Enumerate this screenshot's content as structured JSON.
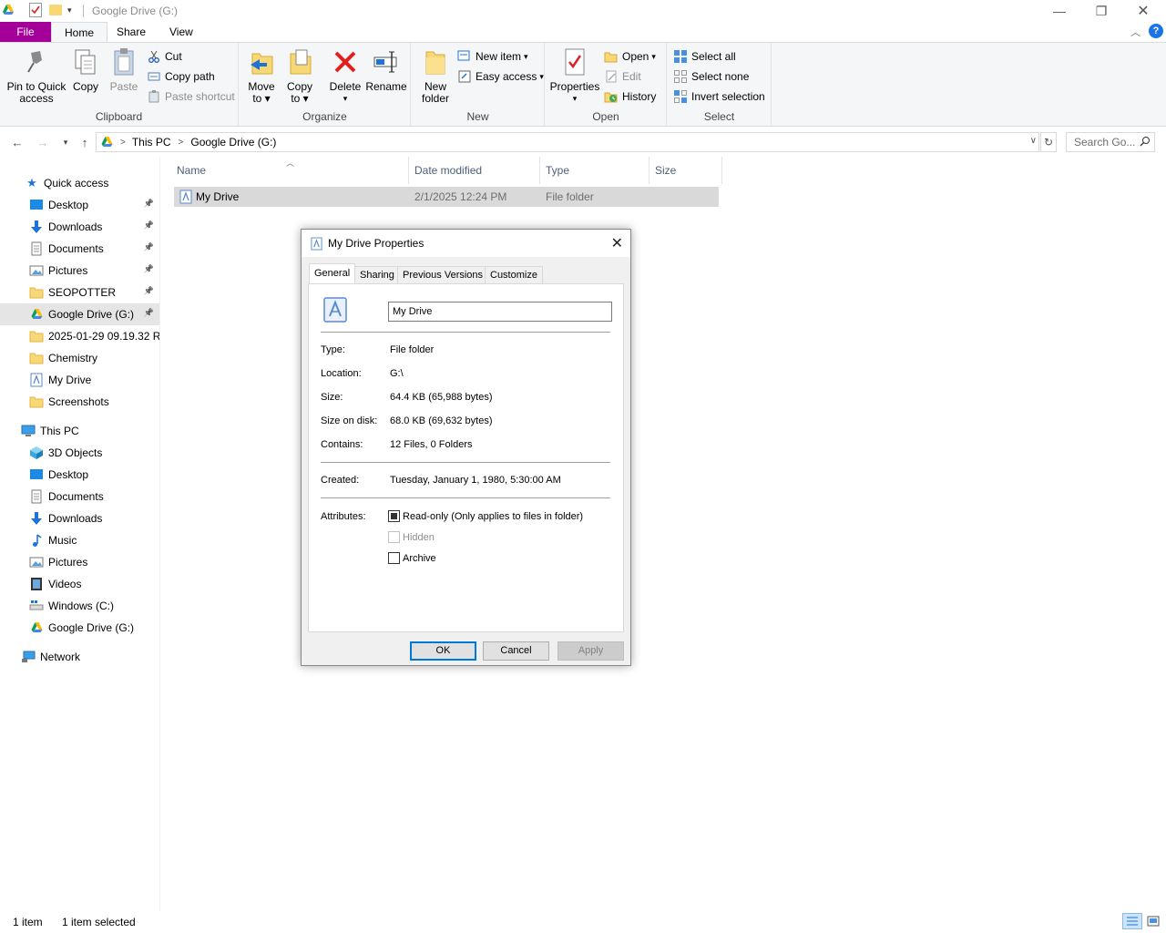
{
  "window": {
    "title": "Google Drive (G:)"
  },
  "ribbon_tabs": [
    "File",
    "Home",
    "Share",
    "View"
  ],
  "ribbon": {
    "clipboard": {
      "pin_label_1": "Pin to Quick",
      "pin_label_2": "access",
      "copy": "Copy",
      "paste": "Paste",
      "cut": "Cut",
      "copy_path": "Copy path",
      "paste_shortcut": "Paste shortcut",
      "group": "Clipboard"
    },
    "organize": {
      "move_1": "Move",
      "move_2": "to",
      "copy_1": "Copy",
      "copy_2": "to",
      "delete": "Delete",
      "rename": "Rename",
      "group": "Organize"
    },
    "new": {
      "new_folder_1": "New",
      "new_folder_2": "folder",
      "new_item": "New item",
      "easy_access": "Easy access",
      "group": "New"
    },
    "open": {
      "properties": "Properties",
      "open": "Open",
      "edit": "Edit",
      "history": "History",
      "group": "Open"
    },
    "select": {
      "select_all": "Select all",
      "select_none": "Select none",
      "invert": "Invert selection",
      "group": "Select"
    }
  },
  "address": {
    "crumbs": [
      "This PC",
      "Google Drive (G:)"
    ],
    "search_placeholder": "Search Go..."
  },
  "navpane": {
    "quick_access": "Quick access",
    "quick_items": [
      "Desktop",
      "Downloads",
      "Documents",
      "Pictures",
      "SEOPOTTER",
      "Google Drive (G:)",
      "2025-01-29 09.19.32 Re",
      "Chemistry",
      "My Drive",
      "Screenshots"
    ],
    "this_pc": "This PC",
    "pc_items": [
      "3D Objects",
      "Desktop",
      "Documents",
      "Downloads",
      "Music",
      "Pictures",
      "Videos",
      "Windows (C:)",
      "Google Drive (G:)"
    ],
    "network": "Network"
  },
  "columns": [
    "Name",
    "Date modified",
    "Type",
    "Size"
  ],
  "files": [
    {
      "name": "My Drive",
      "date": "2/1/2025 12:24 PM",
      "type": "File folder",
      "size": ""
    }
  ],
  "status": {
    "count": "1 item",
    "selected": "1 item selected"
  },
  "dialog": {
    "title": "My Drive Properties",
    "tabs": [
      "General",
      "Sharing",
      "Previous Versions",
      "Customize"
    ],
    "name_value": "My Drive",
    "fields": {
      "type_label": "Type:",
      "type_value": "File folder",
      "location_label": "Location:",
      "location_value": "G:\\",
      "size_label": "Size:",
      "size_value": "64.4 KB (65,988 bytes)",
      "disk_label": "Size on disk:",
      "disk_value": "68.0 KB (69,632 bytes)",
      "contains_label": "Contains:",
      "contains_value": "12 Files, 0 Folders",
      "created_label": "Created:",
      "created_value": "Tuesday, January 1, 1980, 5:30:00 AM",
      "attributes_label": "Attributes:"
    },
    "attributes": {
      "readonly": "Read-only (Only applies to files in folder)",
      "hidden": "Hidden",
      "archive": "Archive"
    },
    "buttons": {
      "ok": "OK",
      "cancel": "Cancel",
      "apply": "Apply"
    }
  },
  "colors": {
    "file_tab": "#a40099",
    "accent": "#0078d7",
    "selection": "#d9d9d9"
  }
}
